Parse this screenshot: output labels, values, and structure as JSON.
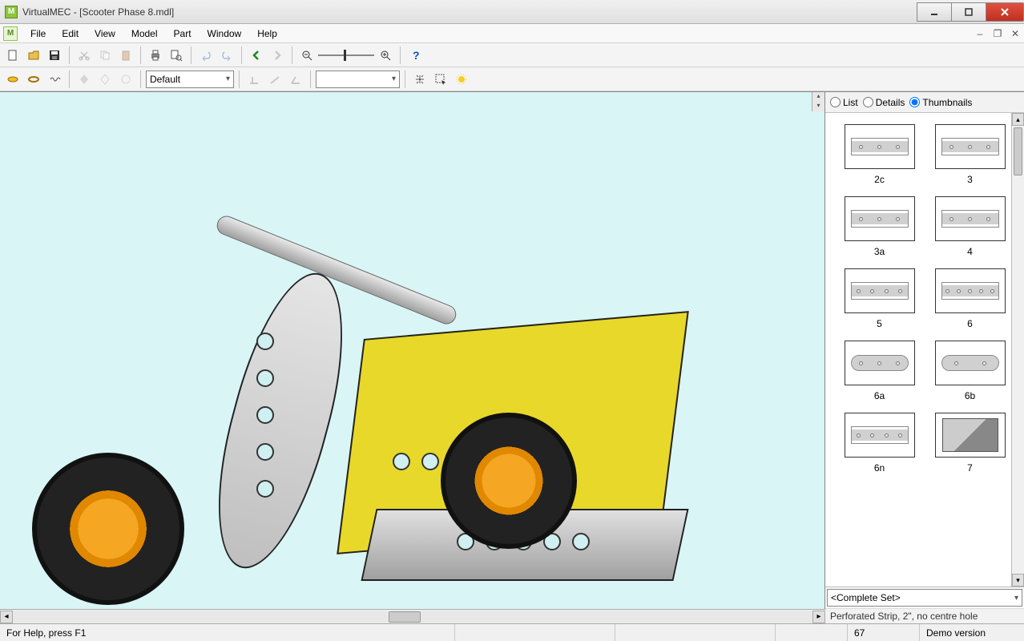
{
  "title": "VirtualMEC - [Scooter Phase 8.mdl]",
  "menu": {
    "file": "File",
    "edit": "Edit",
    "view": "View",
    "model": "Model",
    "part": "Part",
    "window": "Window",
    "help": "Help"
  },
  "toolbar2": {
    "style_combo": "Default",
    "color_combo": ""
  },
  "panel": {
    "view_list": "List",
    "view_details": "Details",
    "view_thumbnails": "Thumbnails",
    "parts": [
      "2c",
      "3",
      "3a",
      "4",
      "5",
      "6",
      "6a",
      "6b",
      "6n",
      "7"
    ],
    "set_combo": "<Complete Set>",
    "description": "Perforated Strip, 2\", no centre hole"
  },
  "status": {
    "help": "For Help, press F1",
    "count": "67",
    "mode": "Demo version"
  }
}
